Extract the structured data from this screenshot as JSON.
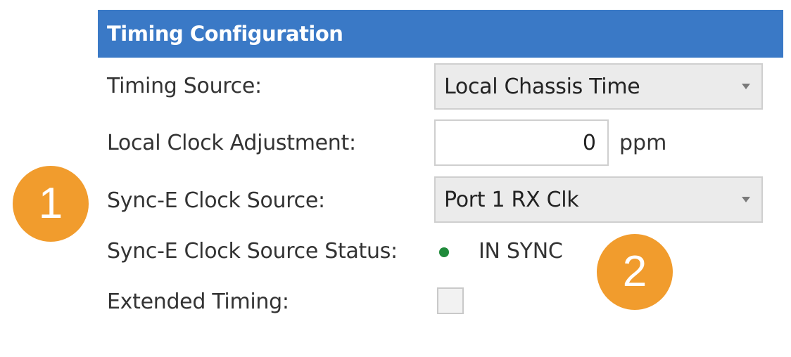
{
  "panel": {
    "title": "Timing Configuration"
  },
  "fields": {
    "timing_source": {
      "label": "Timing Source:",
      "value": "Local Chassis Time"
    },
    "local_clock_adjustment": {
      "label": "Local Clock Adjustment:",
      "value": "0",
      "unit": "ppm"
    },
    "sync_e_clock_source": {
      "label": "Sync-E Clock Source:",
      "value": "Port 1 RX Clk"
    },
    "sync_e_clock_source_status": {
      "label": "Sync-E Clock Source Status:",
      "value": "IN SYNC",
      "indicator_color": "#1f8a3a"
    },
    "extended_timing": {
      "label": "Extended Timing:",
      "checked": false
    }
  },
  "callouts": {
    "one": "1",
    "two": "2"
  },
  "colors": {
    "header_bg": "#3a79c6",
    "callout_bg": "#f19c2d",
    "status_green": "#1f8a3a"
  }
}
